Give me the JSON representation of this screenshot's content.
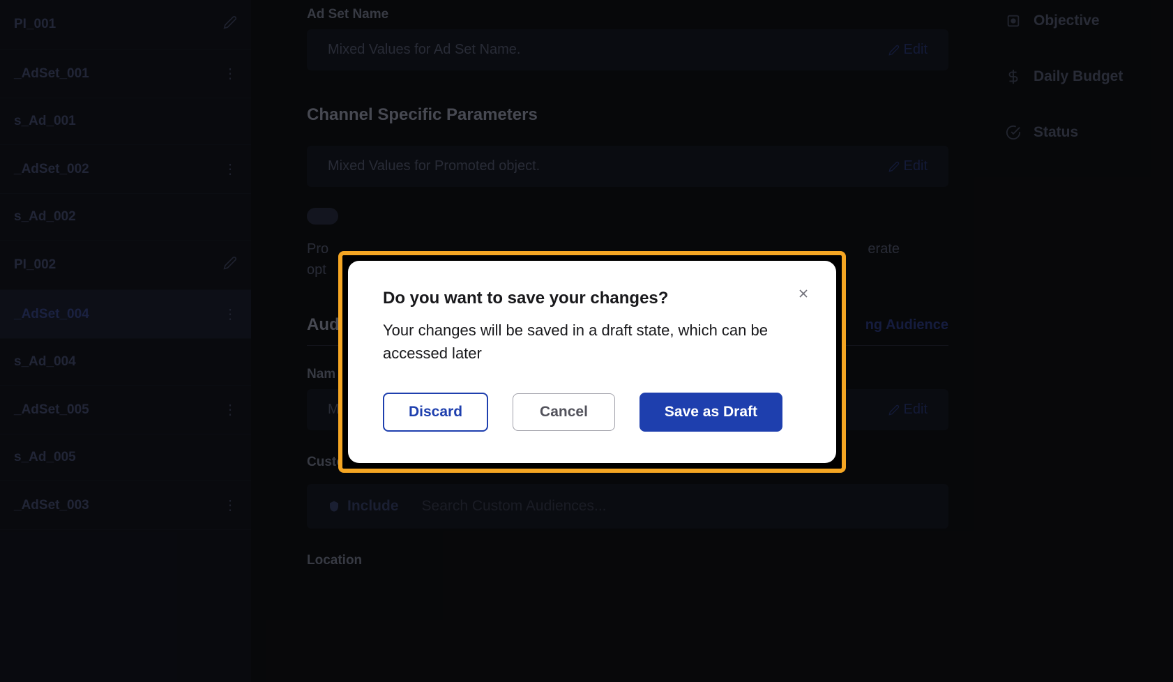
{
  "sidebar": {
    "items": [
      {
        "label": "PI_001",
        "icon": "edit"
      },
      {
        "label": "_AdSet_001",
        "icon": "more"
      },
      {
        "label": "s_Ad_001",
        "icon": ""
      },
      {
        "label": "_AdSet_002",
        "icon": "more"
      },
      {
        "label": "s_Ad_002",
        "icon": ""
      },
      {
        "label": "PI_002",
        "icon": "edit"
      },
      {
        "label": "_AdSet_004",
        "icon": "more",
        "selected": true
      },
      {
        "label": "s_Ad_004",
        "icon": ""
      },
      {
        "label": "_AdSet_005",
        "icon": "more"
      },
      {
        "label": "s_Ad_005",
        "icon": ""
      },
      {
        "label": "_AdSet_003",
        "icon": "more"
      }
    ]
  },
  "main": {
    "adSetNameLabel": "Ad Set Name",
    "adSetNameValue": "Mixed Values for Ad Set Name.",
    "editLabel": "Edit",
    "channelParamsTitle": "Channel Specific Parameters",
    "promotedObjectValue": "Mixed Values for Promoted object.",
    "helperText1": "Pro",
    "helperText2": "erate",
    "helperText3": "opt",
    "audienceTitle": "Aud",
    "audienceAction": "ng Audience",
    "nameLabel": "Nam",
    "nameValue": "Mixed Values for Name.",
    "customAudiencesLabel": "Custom Audiences",
    "includeLabel": "Include",
    "includePlaceholder": "Search Custom Audiences...",
    "locationLabel": "Location"
  },
  "rightPanel": {
    "items": [
      {
        "label": "Objective",
        "icon": "target"
      },
      {
        "label": "Daily Budget",
        "icon": "dollar"
      },
      {
        "label": "Status",
        "icon": "check"
      }
    ]
  },
  "modal": {
    "title": "Do you want to save your changes?",
    "description": "Your changes will be saved in a draft state, which can be accessed later",
    "discardLabel": "Discard",
    "cancelLabel": "Cancel",
    "saveLabel": "Save as Draft"
  }
}
